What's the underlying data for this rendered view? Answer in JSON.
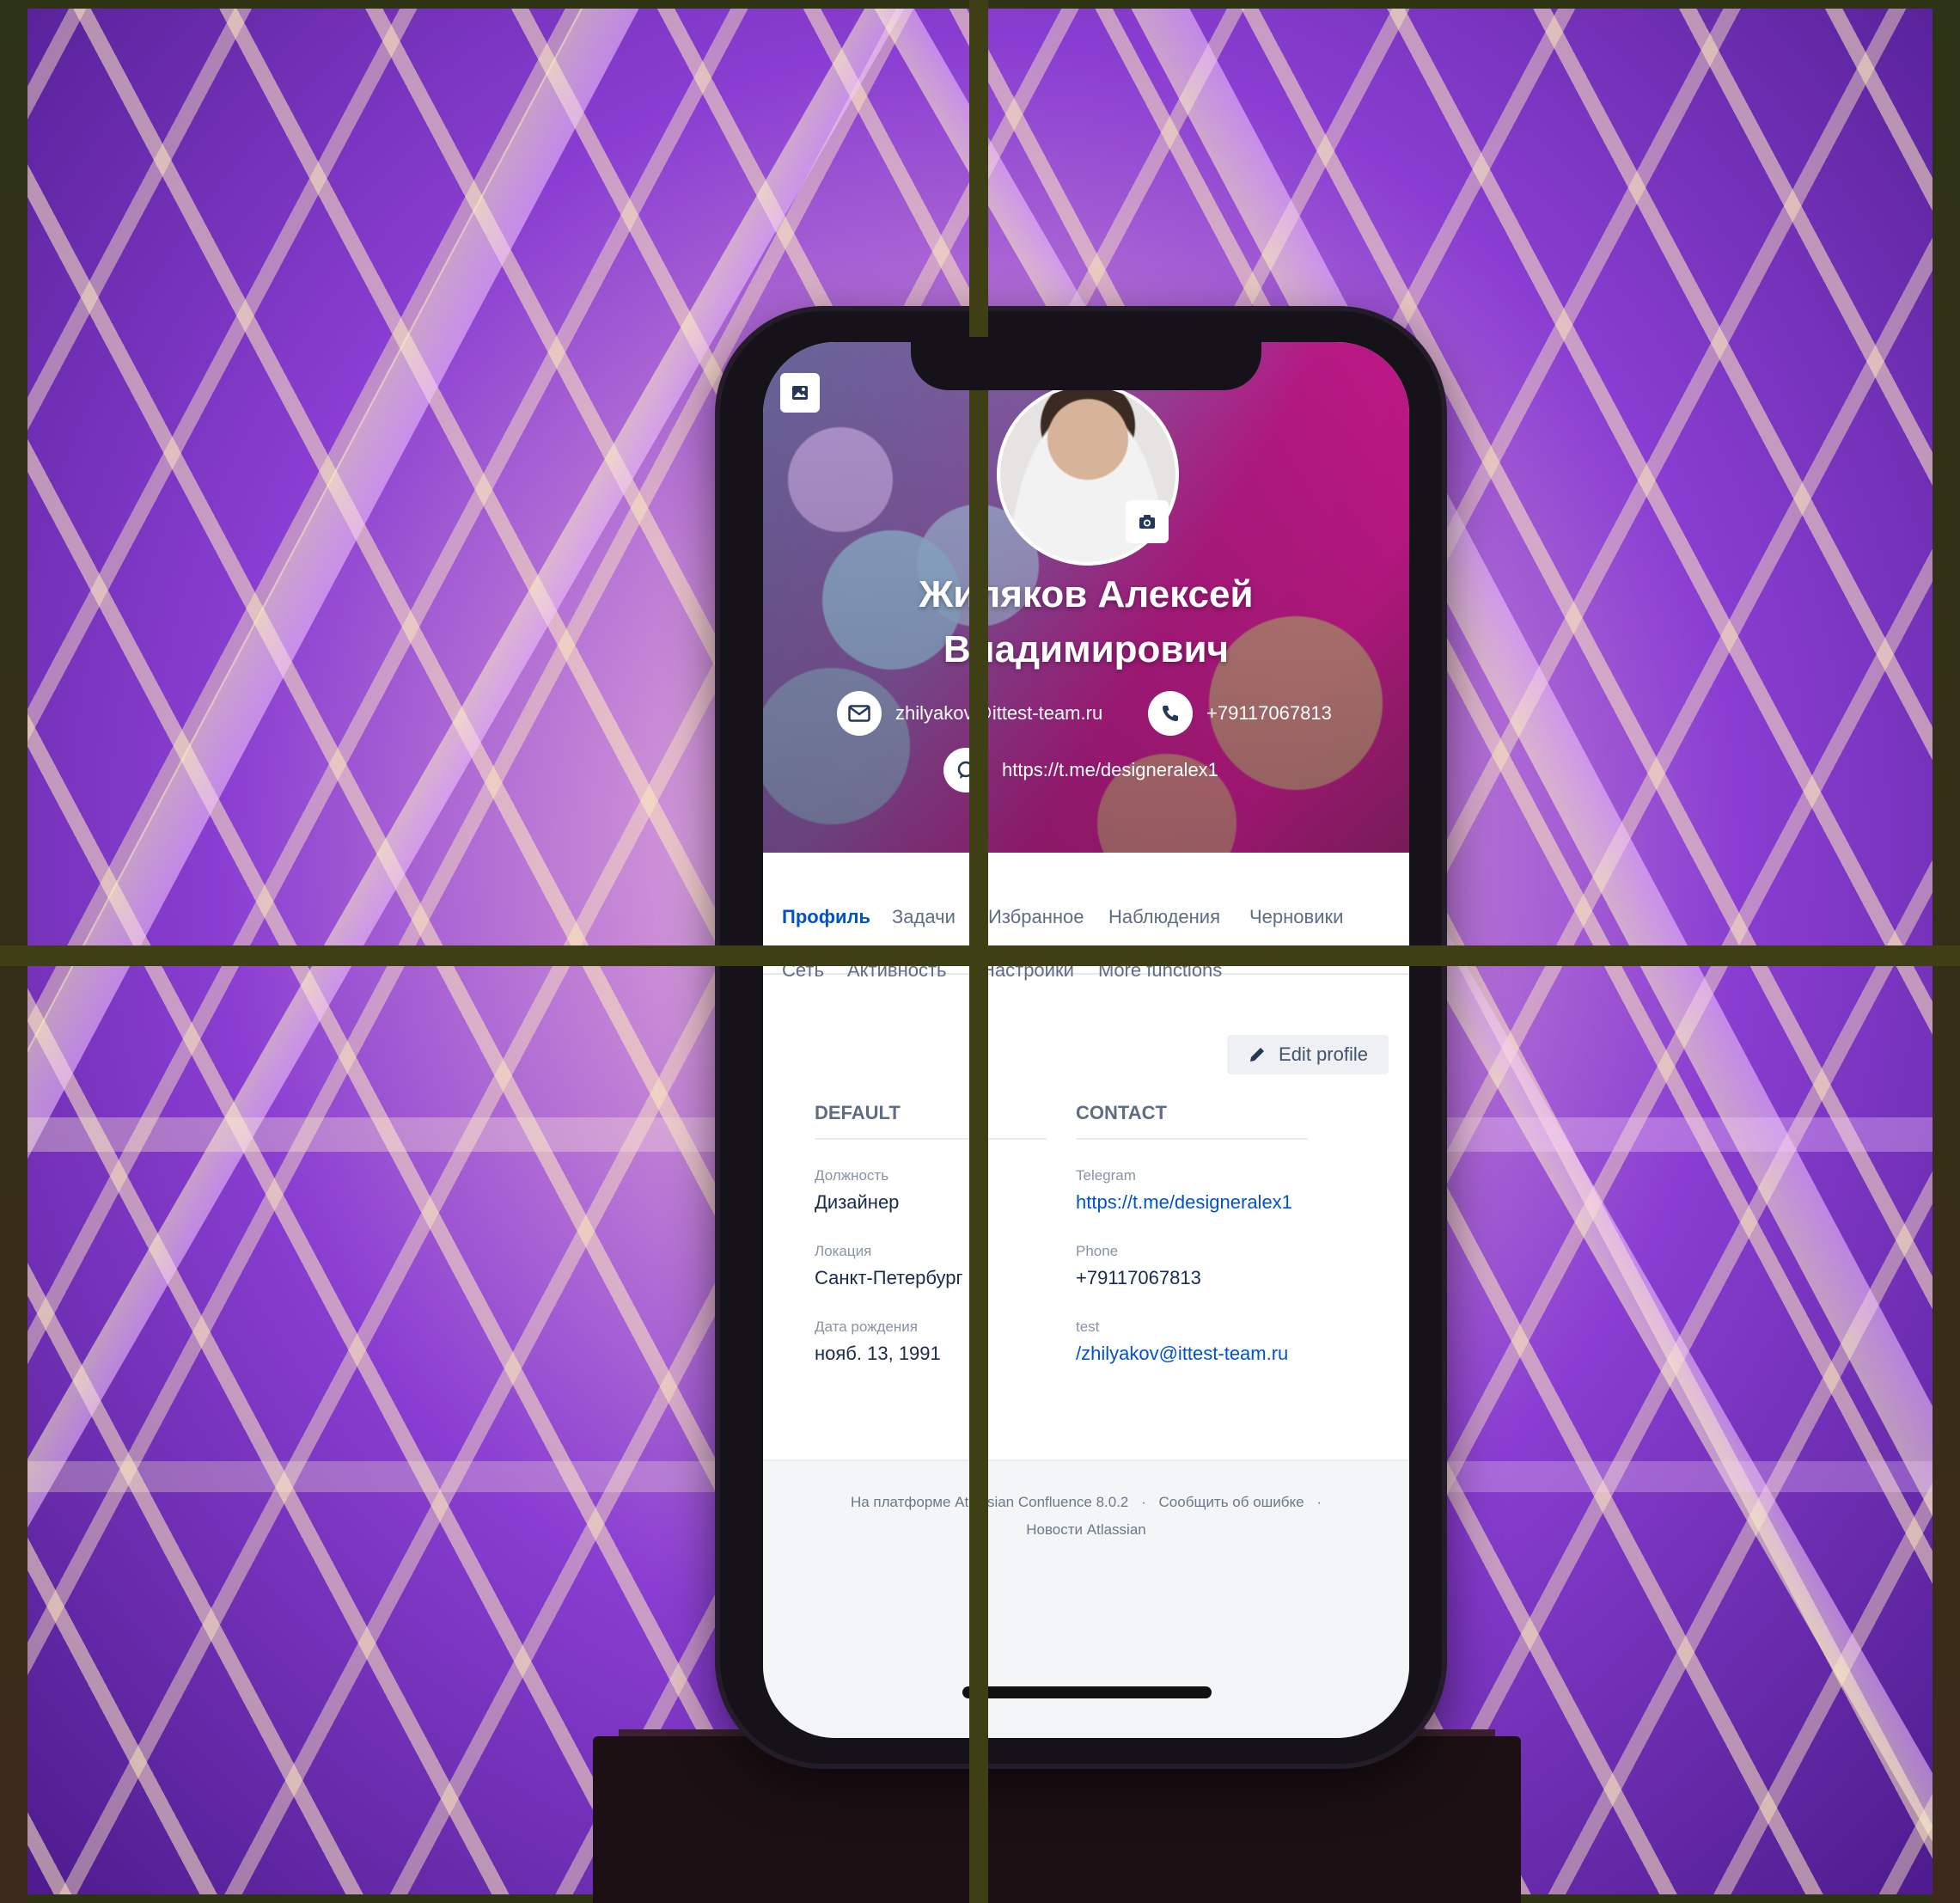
{
  "profile": {
    "name_line1": "Жиляков Алексей",
    "name_line2": "Владимирович",
    "email": "zhilyakov@ittest-team.ru",
    "phone": "+79117067813",
    "telegram_link": "https://t.me/designeralex1"
  },
  "tabs": {
    "row1": [
      "Профиль",
      "Задачи",
      "Избранное",
      "Наблюдения",
      "Черновики"
    ],
    "row2": [
      "Сеть",
      "Активность",
      "Настройки",
      "More functions"
    ]
  },
  "actions": {
    "edit_profile": "Edit profile"
  },
  "sections": {
    "default": {
      "title": "DEFAULT",
      "fields": [
        {
          "label": "Должность",
          "value": "Дизайнер"
        },
        {
          "label": "Локация",
          "value": "Санкт-Петербург"
        },
        {
          "label": "Дата рождения",
          "value": "нояб. 13, 1991"
        }
      ]
    },
    "contact": {
      "title": "CONTACT",
      "fields": [
        {
          "label": "Telegram",
          "value": "https://t.me/designeralex1"
        },
        {
          "label": "Phone",
          "value": "+79117067813"
        },
        {
          "label": "test",
          "value": "/zhilyakov@ittest-team.ru"
        }
      ]
    }
  },
  "footer": {
    "line1_part1": "На платформе Atlassian Confluence 8.0.2",
    "sep": "·",
    "line1_part2": "Сообщить об ошибке",
    "line2": "Новости Atlassian"
  },
  "colors": {
    "accent": "#0052cc",
    "cover_magenta": "#c01a8a",
    "grid_lines": "#3f3f16"
  },
  "icons": [
    "image-icon",
    "camera-icon",
    "mail-icon",
    "phone-icon",
    "chat-icon",
    "pencil-icon"
  ]
}
